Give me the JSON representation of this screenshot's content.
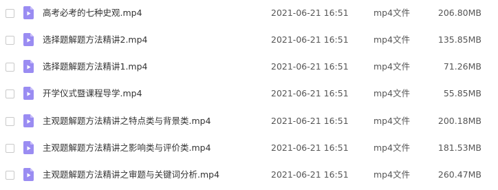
{
  "colors": {
    "icon_fill": "#9a8cf2",
    "icon_fold": "#c8befa",
    "icon_glyph": "#ffffff"
  },
  "files": [
    {
      "name": "高考必考的七种史观.mp4",
      "date": "2021-06-21 16:51",
      "type": "mp4文件",
      "size": "206.80MB",
      "icon": "video-file-icon"
    },
    {
      "name": "选择题解题方法精讲2.mp4",
      "date": "2021-06-21 16:51",
      "type": "mp4文件",
      "size": "135.85MB",
      "icon": "video-file-icon"
    },
    {
      "name": "选择题解题方法精讲1.mp4",
      "date": "2021-06-21 16:51",
      "type": "mp4文件",
      "size": "71.26MB",
      "icon": "video-file-icon"
    },
    {
      "name": "开学仪式暨课程导学.mp4",
      "date": "2021-06-21 16:51",
      "type": "mp4文件",
      "size": "55.85MB",
      "icon": "video-file-icon"
    },
    {
      "name": "主观题解题方法精讲之特点类与背景类.mp4",
      "date": "2021-06-21 16:51",
      "type": "mp4文件",
      "size": "200.18MB",
      "icon": "video-file-icon"
    },
    {
      "name": "主观题解题方法精讲之影响类与评价类.mp4",
      "date": "2021-06-21 16:51",
      "type": "mp4文件",
      "size": "181.53MB",
      "icon": "video-file-icon"
    },
    {
      "name": "主观题解题方法精讲之审题与关键词分析.mp4",
      "date": "2021-06-21 16:51",
      "type": "mp4文件",
      "size": "260.47MB",
      "icon": "video-file-icon"
    }
  ]
}
